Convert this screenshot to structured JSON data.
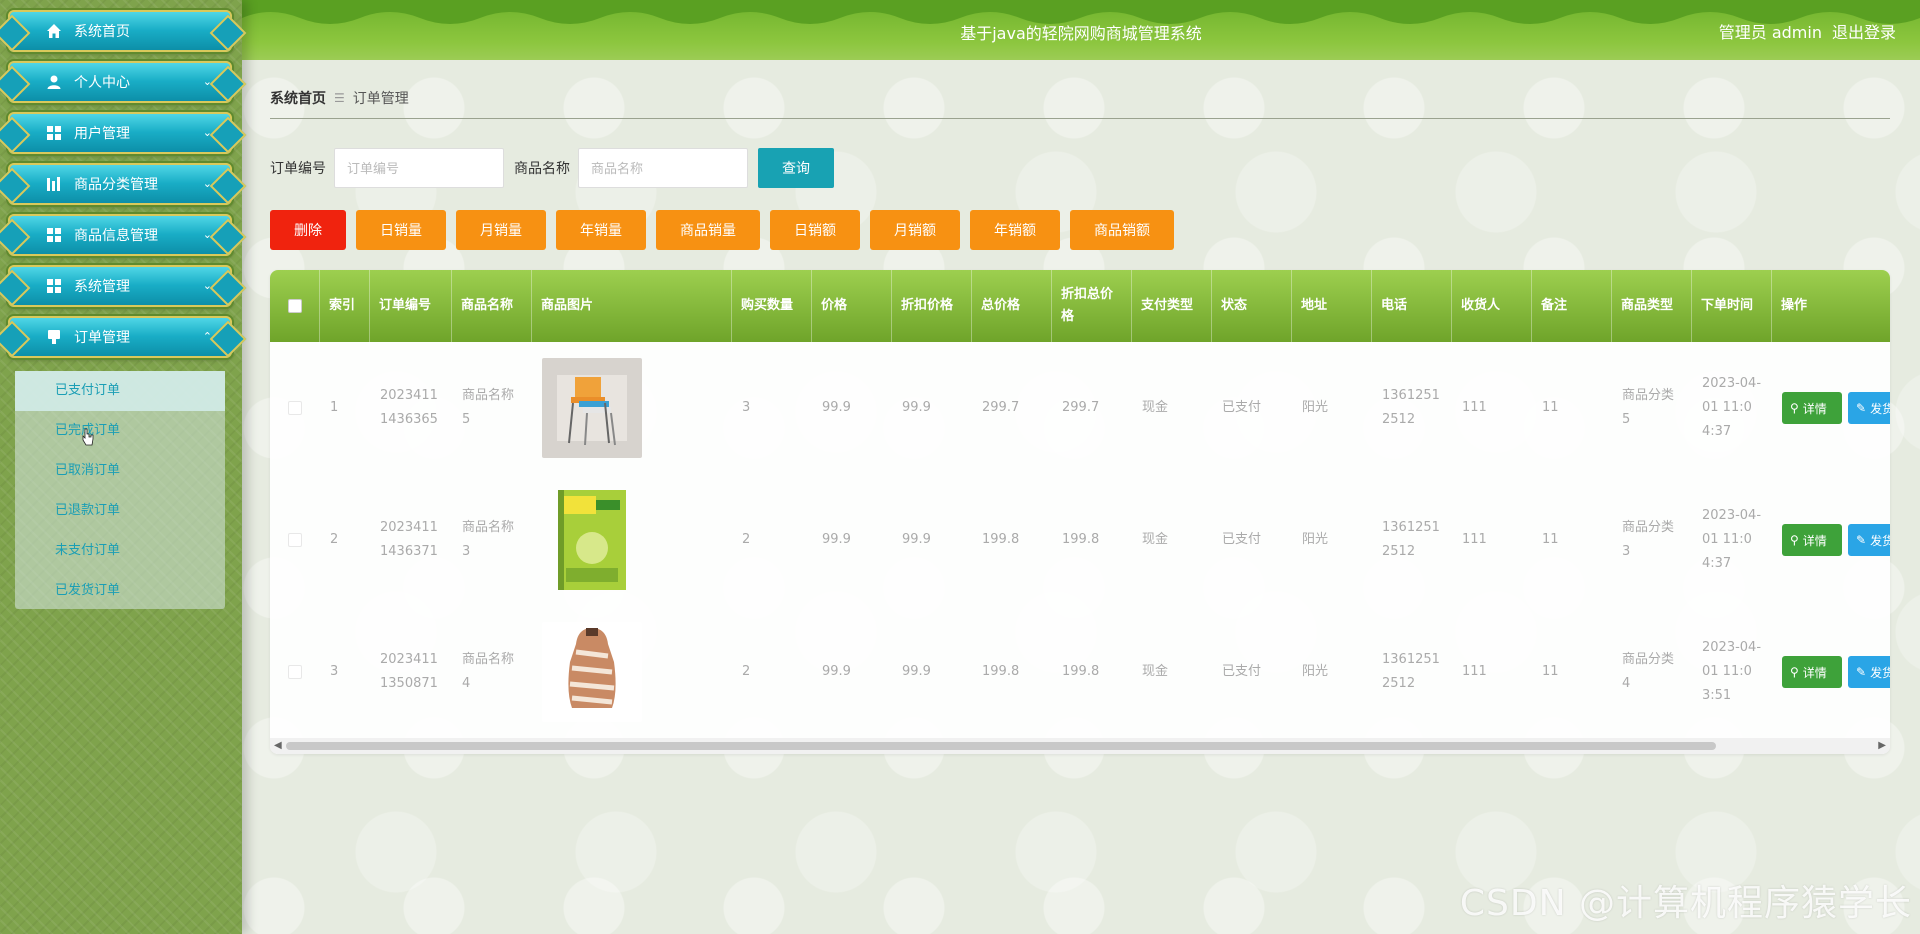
{
  "sidebar": {
    "items": [
      {
        "label": "系统首页",
        "icon": "home-icon"
      },
      {
        "label": "个人中心",
        "icon": "user-icon"
      },
      {
        "label": "用户管理",
        "icon": "grid-icon"
      },
      {
        "label": "商品分类管理",
        "icon": "chart-icon"
      },
      {
        "label": "商品信息管理",
        "icon": "grid-icon"
      },
      {
        "label": "系统管理",
        "icon": "grid-icon"
      },
      {
        "label": "订单管理",
        "icon": "order-icon"
      }
    ],
    "submenu": [
      "已支付订单",
      "已完成订单",
      "已取消订单",
      "已退款订单",
      "未支付订单",
      "已发货订单"
    ]
  },
  "header": {
    "title": "基于java的轻院网购商城管理系统",
    "user": "管理员 admin",
    "logout": "退出登录"
  },
  "breadcrumb": {
    "home": "系统首页",
    "sep": "☰",
    "current": "订单管理"
  },
  "search": {
    "order_label": "订单编号",
    "order_placeholder": "订单编号",
    "product_label": "商品名称",
    "product_placeholder": "商品名称",
    "button": "查询"
  },
  "actions": {
    "delete": "删除",
    "stats": [
      "日销量",
      "月销量",
      "年销量",
      "商品销量",
      "日销额",
      "月销额",
      "年销额",
      "商品销额"
    ]
  },
  "table": {
    "headers": [
      "",
      "索引",
      "订单编号",
      "商品名称",
      "商品图片",
      "购买数量",
      "价格",
      "折扣价格",
      "总价格",
      "折扣总价格",
      "支付类型",
      "状态",
      "地址",
      "电话",
      "收货人",
      "备注",
      "商品类型",
      "下单时间",
      "操作"
    ],
    "rows": [
      {
        "index": "1",
        "order_no": "20234111436365",
        "product": "商品名称5",
        "image": "chairs",
        "qty": "3",
        "price": "99.9",
        "discount_price": "99.9",
        "total": "299.7",
        "discount_total": "299.7",
        "pay_type": "现金",
        "status": "已支付",
        "address": "阳光",
        "phone": "13612512512",
        "receiver": "111",
        "remark": "11",
        "category": "商品分类5",
        "time": "2023-04-01 11:04:37"
      },
      {
        "index": "2",
        "order_no": "20234111436371",
        "product": "商品名称3",
        "image": "book",
        "qty": "2",
        "price": "99.9",
        "discount_price": "99.9",
        "total": "199.8",
        "discount_total": "199.8",
        "pay_type": "现金",
        "status": "已支付",
        "address": "阳光",
        "phone": "13612512512",
        "receiver": "111",
        "remark": "11",
        "category": "商品分类3",
        "time": "2023-04-01 11:04:37"
      },
      {
        "index": "3",
        "order_no": "20234111350871",
        "product": "商品名称4",
        "image": "backpack",
        "qty": "2",
        "price": "99.9",
        "discount_price": "99.9",
        "total": "199.8",
        "discount_total": "199.8",
        "pay_type": "现金",
        "status": "已支付",
        "address": "阳光",
        "phone": "13612512512",
        "receiver": "111",
        "remark": "11",
        "category": "商品分类4",
        "time": "2023-04-01 11:03:51"
      }
    ],
    "detail_button": "详情",
    "ship_button": "发货"
  },
  "watermark": "CSDN @计算机程序猿学长",
  "colors": {
    "accent": "#18a2b3",
    "header": "#8cc63e",
    "danger": "#f0230e",
    "warning": "#f79112"
  }
}
